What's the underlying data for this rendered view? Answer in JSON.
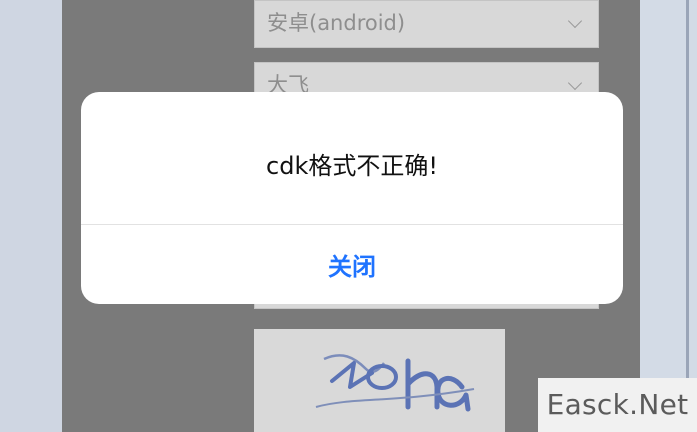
{
  "form": {
    "platform_select": {
      "value": "安卓(android)"
    },
    "partial_select": {
      "value": "大飞"
    }
  },
  "captcha": {
    "text": "zoha"
  },
  "modal": {
    "message": "cdk格式不正确!",
    "close_label": "关闭"
  },
  "watermark": {
    "text": "Easck.Net"
  },
  "icons": {
    "dropdown": "chevron-down-icon"
  },
  "colors": {
    "modal_button": "#1f73ff",
    "overlay": "#7a7a7a",
    "page_background": "#cfd6e2"
  }
}
